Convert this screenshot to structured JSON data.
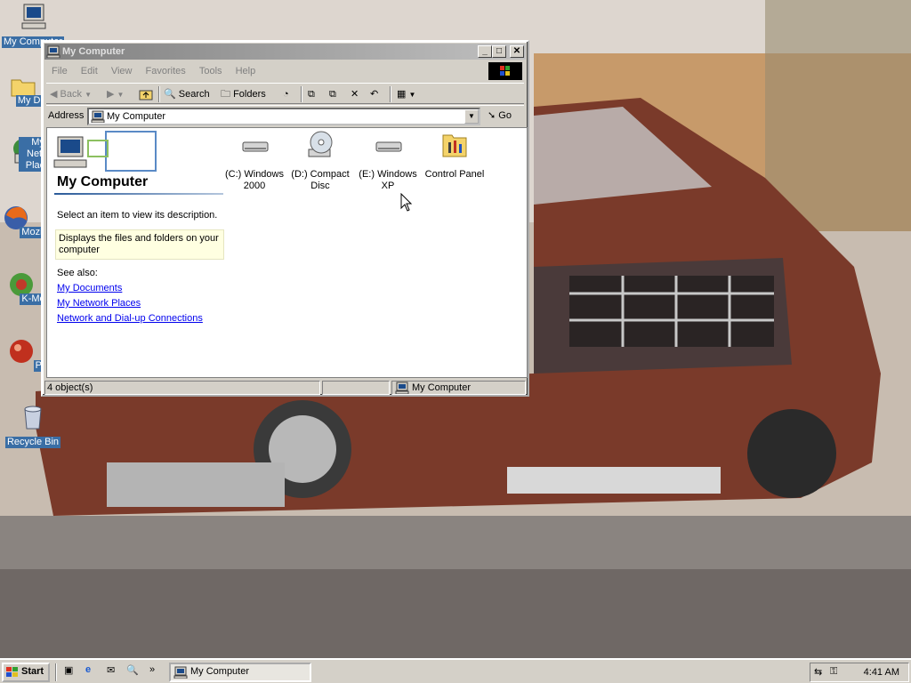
{
  "desktop": {
    "icons": [
      {
        "label": "My Computer"
      },
      {
        "label": "My Docu"
      },
      {
        "label": "My Netw Place"
      },
      {
        "label": "Mozilla Fi"
      },
      {
        "label": "K-Melec"
      },
      {
        "label": "Pega"
      },
      {
        "label": "Recycle Bin"
      }
    ]
  },
  "window": {
    "title": "My Computer",
    "controls": {
      "minimize": "_",
      "maximize": "□",
      "close": "✕"
    },
    "menu": [
      "File",
      "Edit",
      "View",
      "Favorites",
      "Tools",
      "Help"
    ],
    "toolbar": {
      "back": "Back",
      "search": "Search",
      "folders": "Folders"
    },
    "address": {
      "label": "Address",
      "value": "My Computer",
      "go": "Go"
    },
    "left_pane": {
      "title": "My Computer",
      "description": "Select an item to view its description.",
      "info": "Displays the files and folders on your computer",
      "see_also": "See also:",
      "links": [
        "My Documents",
        "My Network Places",
        "Network and Dial-up Connections"
      ]
    },
    "items": [
      {
        "line1": "(C:) Windows",
        "line2": "2000",
        "icon": "hard-drive-icon"
      },
      {
        "line1": "(D:) Compact",
        "line2": "Disc",
        "icon": "cd-drive-icon"
      },
      {
        "line1": "(E:) Windows",
        "line2": "XP",
        "icon": "hard-drive-icon"
      },
      {
        "line1": "Control Panel",
        "line2": "",
        "icon": "control-panel-icon"
      }
    ],
    "status": {
      "count": "4 object(s)",
      "zone": "My Computer"
    }
  },
  "taskbar": {
    "start": "Start",
    "task": "My Computer",
    "clock": "4:41 AM",
    "chevron": "»"
  }
}
